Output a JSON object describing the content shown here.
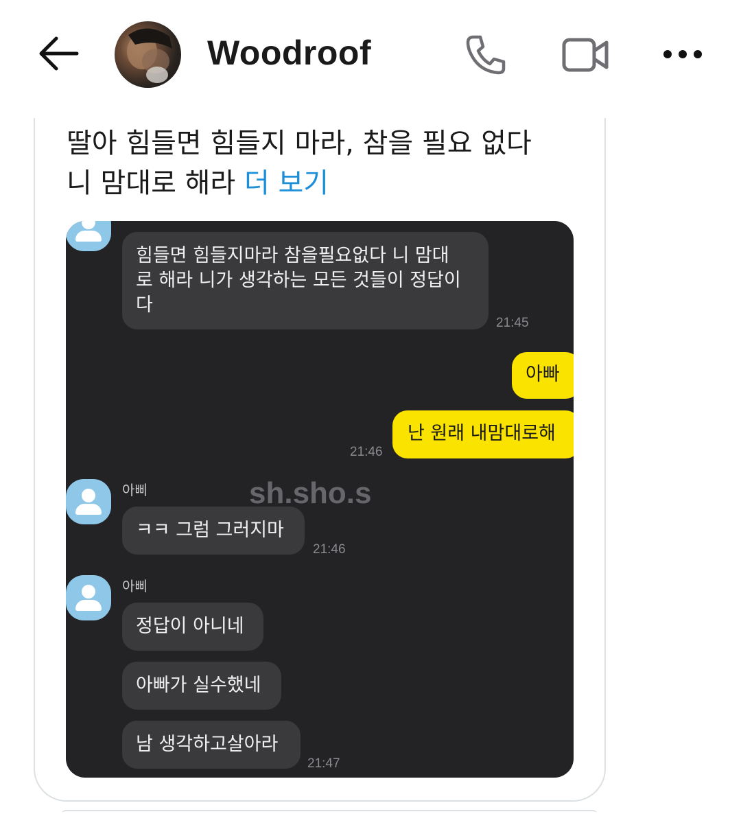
{
  "header": {
    "back_icon": "arrow-left-icon",
    "title": "Woodroof",
    "call_icon": "phone-icon",
    "video_icon": "video-camera-icon",
    "more_icon": "more-horizontal-icon"
  },
  "post": {
    "text": "딸아 힘들면 힘들지 마라, 참을 필요 없다\n니 맘대로 해라 ",
    "more_link": "더 보기",
    "link_color": "#1d8fd8"
  },
  "chat": {
    "background": "#232326",
    "my_bubble_color": "#fbe300",
    "messages": [
      {
        "text": "힘들면 힘들지마라 참을필요없다 니 맘대\n로 해라 니가 생각하는 모든 것들이 정답이\n다",
        "time": "21:45"
      },
      {
        "text": "아빠"
      },
      {
        "text": "난 원래 내맘대로해",
        "time": "21:46"
      },
      {
        "sender": "아삐",
        "text": "ㅋㅋ 그럼 그러지마",
        "time": "21:46"
      },
      {
        "sender": "아삐",
        "text": "정답이 아니네"
      },
      {
        "text": "아빠가 실수했네"
      },
      {
        "text": "남 생각하고살아라",
        "time": "21:47"
      }
    ],
    "watermark": "sh.sho.s"
  }
}
